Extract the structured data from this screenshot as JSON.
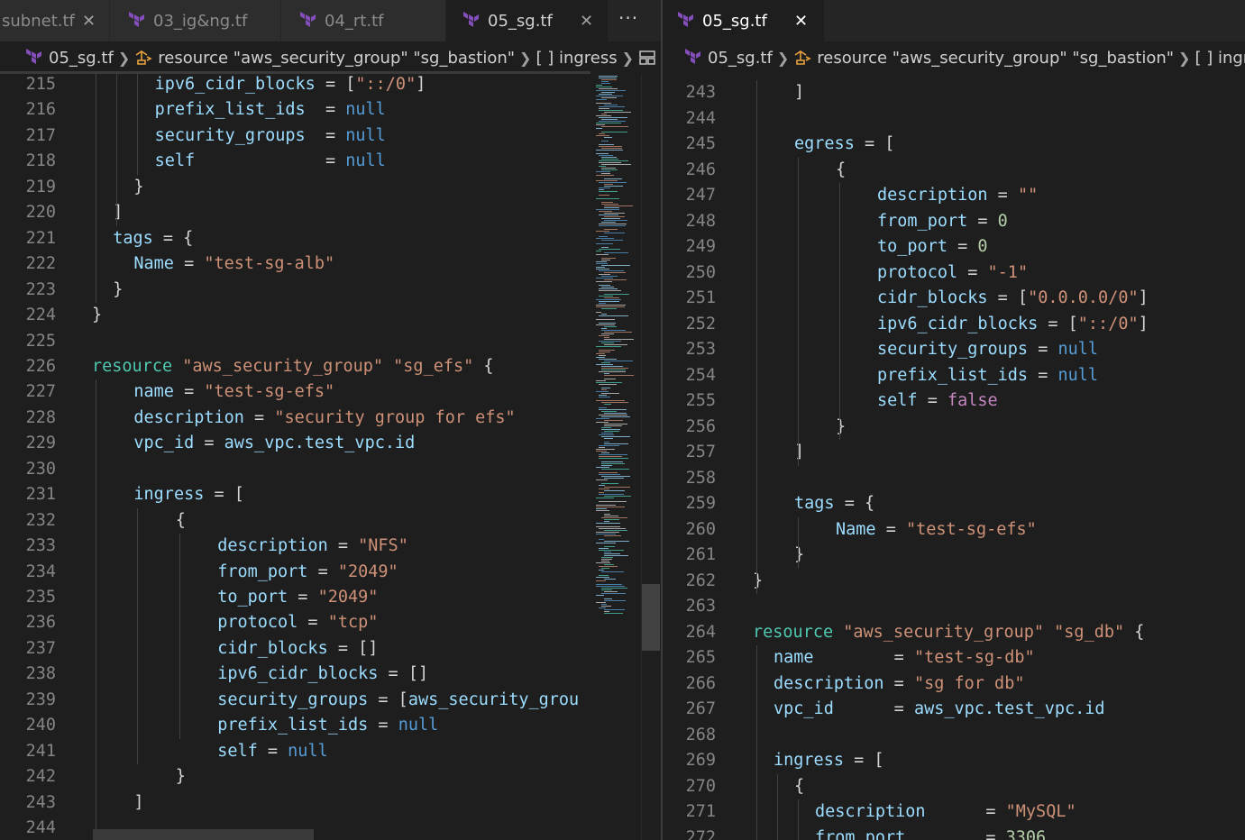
{
  "left_pane": {
    "tabs": [
      {
        "label": "subnet.tf",
        "active": false,
        "has_close": true
      },
      {
        "label": "03_ig&ng.tf",
        "active": false,
        "has_close": false
      },
      {
        "label": "04_rt.tf",
        "active": false,
        "has_close": false
      },
      {
        "label": "05_sg.tf",
        "active": true,
        "has_close": true
      }
    ],
    "more_label": "···",
    "breadcrumb": {
      "file": "05_sg.tf",
      "resource": "resource \"aws_security_group\" \"sg_bastion\"",
      "block": "[ ] ingress",
      "item": "0"
    },
    "lines": [
      {
        "n": "215",
        "i": 3,
        "t": [
          [
            "k",
            "ipv6_cidr_blocks"
          ],
          [
            "o",
            " = "
          ],
          [
            "o",
            "["
          ],
          [
            "s",
            "\"::/0\""
          ],
          [
            "o",
            "]"
          ]
        ]
      },
      {
        "n": "216",
        "i": 3,
        "t": [
          [
            "k",
            "prefix_list_ids"
          ],
          [
            "o",
            "  = "
          ],
          [
            "kw",
            "null"
          ]
        ]
      },
      {
        "n": "217",
        "i": 3,
        "t": [
          [
            "k",
            "security_groups"
          ],
          [
            "o",
            "  = "
          ],
          [
            "kw",
            "null"
          ]
        ]
      },
      {
        "n": "218",
        "i": 3,
        "t": [
          [
            "k",
            "self"
          ],
          [
            "o",
            "             = "
          ],
          [
            "kw",
            "null"
          ]
        ]
      },
      {
        "n": "219",
        "i": 2,
        "t": [
          [
            "o",
            "}"
          ]
        ]
      },
      {
        "n": "220",
        "i": 1,
        "t": [
          [
            "o",
            "]"
          ]
        ]
      },
      {
        "n": "221",
        "i": 1,
        "t": [
          [
            "k",
            "tags"
          ],
          [
            "o",
            " = {"
          ]
        ]
      },
      {
        "n": "222",
        "i": 2,
        "t": [
          [
            "k",
            "Name"
          ],
          [
            "o",
            " = "
          ],
          [
            "s",
            "\"test-sg-alb\""
          ]
        ]
      },
      {
        "n": "223",
        "i": 1,
        "t": [
          [
            "o",
            "}"
          ]
        ]
      },
      {
        "n": "224",
        "i": 0,
        "t": [
          [
            "o",
            "}"
          ]
        ]
      },
      {
        "n": "225",
        "i": 0,
        "t": []
      },
      {
        "n": "226",
        "i": 0,
        "t": [
          [
            "r",
            "resource"
          ],
          [
            "o",
            " "
          ],
          [
            "s",
            "\"aws_security_group\""
          ],
          [
            "o",
            " "
          ],
          [
            "s",
            "\"sg_efs\""
          ],
          [
            "o",
            " {"
          ]
        ]
      },
      {
        "n": "227",
        "i": 2,
        "t": [
          [
            "k",
            "name"
          ],
          [
            "o",
            " = "
          ],
          [
            "s",
            "\"test-sg-efs\""
          ]
        ]
      },
      {
        "n": "228",
        "i": 2,
        "t": [
          [
            "k",
            "description"
          ],
          [
            "o",
            " = "
          ],
          [
            "s",
            "\"security group for efs\""
          ]
        ]
      },
      {
        "n": "229",
        "i": 2,
        "t": [
          [
            "k",
            "vpc_id"
          ],
          [
            "o",
            " = "
          ],
          [
            "k",
            "aws_vpc.test_vpc.id"
          ]
        ]
      },
      {
        "n": "230",
        "i": 0,
        "t": []
      },
      {
        "n": "231",
        "i": 2,
        "t": [
          [
            "k",
            "ingress"
          ],
          [
            "o",
            " = ["
          ]
        ]
      },
      {
        "n": "232",
        "i": 4,
        "t": [
          [
            "o",
            "{"
          ]
        ]
      },
      {
        "n": "233",
        "i": 6,
        "t": [
          [
            "k",
            "description"
          ],
          [
            "o",
            " = "
          ],
          [
            "s",
            "\"NFS\""
          ]
        ]
      },
      {
        "n": "234",
        "i": 6,
        "t": [
          [
            "k",
            "from_port"
          ],
          [
            "o",
            " = "
          ],
          [
            "s",
            "\"2049\""
          ]
        ]
      },
      {
        "n": "235",
        "i": 6,
        "t": [
          [
            "k",
            "to_port"
          ],
          [
            "o",
            " = "
          ],
          [
            "s",
            "\"2049\""
          ]
        ]
      },
      {
        "n": "236",
        "i": 6,
        "t": [
          [
            "k",
            "protocol"
          ],
          [
            "o",
            " = "
          ],
          [
            "s",
            "\"tcp\""
          ]
        ]
      },
      {
        "n": "237",
        "i": 6,
        "t": [
          [
            "k",
            "cidr_blocks"
          ],
          [
            "o",
            " = []"
          ]
        ]
      },
      {
        "n": "238",
        "i": 6,
        "t": [
          [
            "k",
            "ipv6_cidr_blocks"
          ],
          [
            "o",
            " = []"
          ]
        ]
      },
      {
        "n": "239",
        "i": 6,
        "t": [
          [
            "k",
            "security_groups"
          ],
          [
            "o",
            " = ["
          ],
          [
            "k",
            "aws_security_grou"
          ]
        ]
      },
      {
        "n": "240",
        "i": 6,
        "t": [
          [
            "k",
            "prefix_list_ids"
          ],
          [
            "o",
            " = "
          ],
          [
            "kw",
            "null"
          ]
        ]
      },
      {
        "n": "241",
        "i": 6,
        "t": [
          [
            "k",
            "self"
          ],
          [
            "o",
            " = "
          ],
          [
            "kw",
            "null"
          ]
        ]
      },
      {
        "n": "242",
        "i": 4,
        "t": [
          [
            "o",
            "}"
          ]
        ]
      },
      {
        "n": "243",
        "i": 2,
        "t": [
          [
            "o",
            "]"
          ]
        ]
      },
      {
        "n": "244",
        "i": 0,
        "t": []
      }
    ]
  },
  "right_pane": {
    "tab": {
      "label": "05_sg.tf",
      "active": true
    },
    "breadcrumb": {
      "file": "05_sg.tf",
      "resource": "resource \"aws_security_group\" \"sg_bastion\"",
      "block": "[ ] ingres"
    },
    "lines": [
      {
        "n": "243",
        "i": 2,
        "t": [
          [
            "o",
            "]"
          ]
        ]
      },
      {
        "n": "244",
        "i": 0,
        "t": []
      },
      {
        "n": "245",
        "i": 2,
        "t": [
          [
            "k",
            "egress"
          ],
          [
            "o",
            " = ["
          ]
        ]
      },
      {
        "n": "246",
        "i": 4,
        "t": [
          [
            "o",
            "{"
          ]
        ]
      },
      {
        "n": "247",
        "i": 6,
        "t": [
          [
            "k",
            "description"
          ],
          [
            "o",
            " = "
          ],
          [
            "s",
            "\"\""
          ]
        ]
      },
      {
        "n": "248",
        "i": 6,
        "t": [
          [
            "k",
            "from_port"
          ],
          [
            "o",
            " = "
          ],
          [
            "n",
            "0"
          ]
        ]
      },
      {
        "n": "249",
        "i": 6,
        "t": [
          [
            "k",
            "to_port"
          ],
          [
            "o",
            " = "
          ],
          [
            "n",
            "0"
          ]
        ]
      },
      {
        "n": "250",
        "i": 6,
        "t": [
          [
            "k",
            "protocol"
          ],
          [
            "o",
            " = "
          ],
          [
            "s",
            "\"-1\""
          ]
        ]
      },
      {
        "n": "251",
        "i": 6,
        "t": [
          [
            "k",
            "cidr_blocks"
          ],
          [
            "o",
            " = ["
          ],
          [
            "s",
            "\"0.0.0.0/0\""
          ],
          [
            "o",
            "]"
          ]
        ]
      },
      {
        "n": "252",
        "i": 6,
        "t": [
          [
            "k",
            "ipv6_cidr_blocks"
          ],
          [
            "o",
            " = ["
          ],
          [
            "s",
            "\"::/0\""
          ],
          [
            "o",
            "]"
          ]
        ]
      },
      {
        "n": "253",
        "i": 6,
        "t": [
          [
            "k",
            "security_groups"
          ],
          [
            "o",
            " = "
          ],
          [
            "kw",
            "null"
          ]
        ]
      },
      {
        "n": "254",
        "i": 6,
        "t": [
          [
            "k",
            "prefix_list_ids"
          ],
          [
            "o",
            " = "
          ],
          [
            "kw",
            "null"
          ]
        ]
      },
      {
        "n": "255",
        "i": 6,
        "t": [
          [
            "k",
            "self"
          ],
          [
            "o",
            " = "
          ],
          [
            "f",
            "false"
          ]
        ]
      },
      {
        "n": "256",
        "i": 4,
        "t": [
          [
            "o",
            "}"
          ]
        ]
      },
      {
        "n": "257",
        "i": 2,
        "t": [
          [
            "o",
            "]"
          ]
        ]
      },
      {
        "n": "258",
        "i": 0,
        "t": []
      },
      {
        "n": "259",
        "i": 2,
        "t": [
          [
            "k",
            "tags"
          ],
          [
            "o",
            " = {"
          ]
        ]
      },
      {
        "n": "260",
        "i": 4,
        "t": [
          [
            "k",
            "Name"
          ],
          [
            "o",
            " = "
          ],
          [
            "s",
            "\"test-sg-efs\""
          ]
        ]
      },
      {
        "n": "261",
        "i": 2,
        "t": [
          [
            "o",
            "}"
          ]
        ]
      },
      {
        "n": "262",
        "i": 0,
        "t": [
          [
            "o",
            "}"
          ]
        ]
      },
      {
        "n": "263",
        "i": 0,
        "t": []
      },
      {
        "n": "264",
        "i": 0,
        "t": [
          [
            "r",
            "resource"
          ],
          [
            "o",
            " "
          ],
          [
            "s",
            "\"aws_security_group\""
          ],
          [
            "o",
            " "
          ],
          [
            "s",
            "\"sg_db\""
          ],
          [
            "o",
            " {"
          ]
        ]
      },
      {
        "n": "265",
        "i": 1,
        "t": [
          [
            "k",
            "name"
          ],
          [
            "o",
            "        = "
          ],
          [
            "s",
            "\"test-sg-db\""
          ]
        ]
      },
      {
        "n": "266",
        "i": 1,
        "t": [
          [
            "k",
            "description"
          ],
          [
            "o",
            " = "
          ],
          [
            "s",
            "\"sg for db\""
          ]
        ]
      },
      {
        "n": "267",
        "i": 1,
        "t": [
          [
            "k",
            "vpc_id"
          ],
          [
            "o",
            "      = "
          ],
          [
            "k",
            "aws_vpc.test_vpc.id"
          ]
        ]
      },
      {
        "n": "268",
        "i": 0,
        "t": []
      },
      {
        "n": "269",
        "i": 1,
        "t": [
          [
            "k",
            "ingress"
          ],
          [
            "o",
            " = ["
          ]
        ]
      },
      {
        "n": "270",
        "i": 2,
        "t": [
          [
            "o",
            "{"
          ]
        ]
      },
      {
        "n": "271",
        "i": 3,
        "t": [
          [
            "k",
            "description"
          ],
          [
            "o",
            "      = "
          ],
          [
            "s",
            "\"MySQL\""
          ]
        ]
      },
      {
        "n": "272",
        "i": 3,
        "t": [
          [
            "k",
            "from_port"
          ],
          [
            "o",
            "        = "
          ],
          [
            "n",
            "3306"
          ]
        ]
      }
    ]
  },
  "colors": {
    "background": "#1e1e1e",
    "tab_inactive": "#2d2d2d",
    "terraform_purple": "#844fba",
    "key": "#9cdcfe",
    "string": "#ce9178",
    "number": "#b5cea8",
    "keyword": "#569cd6",
    "resource": "#4ec9b0"
  },
  "icons": [
    "terraform-icon",
    "close-icon",
    "more-actions-icon",
    "chevron-right-icon",
    "resource-icon",
    "array-icon"
  ]
}
